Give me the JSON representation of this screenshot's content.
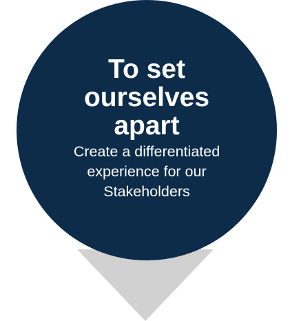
{
  "colors": {
    "bubble": "#0c2c4a",
    "pointer": "#d1d1d1",
    "text": "#ffffff",
    "background": "#ffffff"
  },
  "bubble": {
    "headline": "To set ourselves apart",
    "subtext": "Create a differentiated experience for our Stakeholders"
  },
  "pointer": {
    "icon": "downward-triangle-icon"
  }
}
